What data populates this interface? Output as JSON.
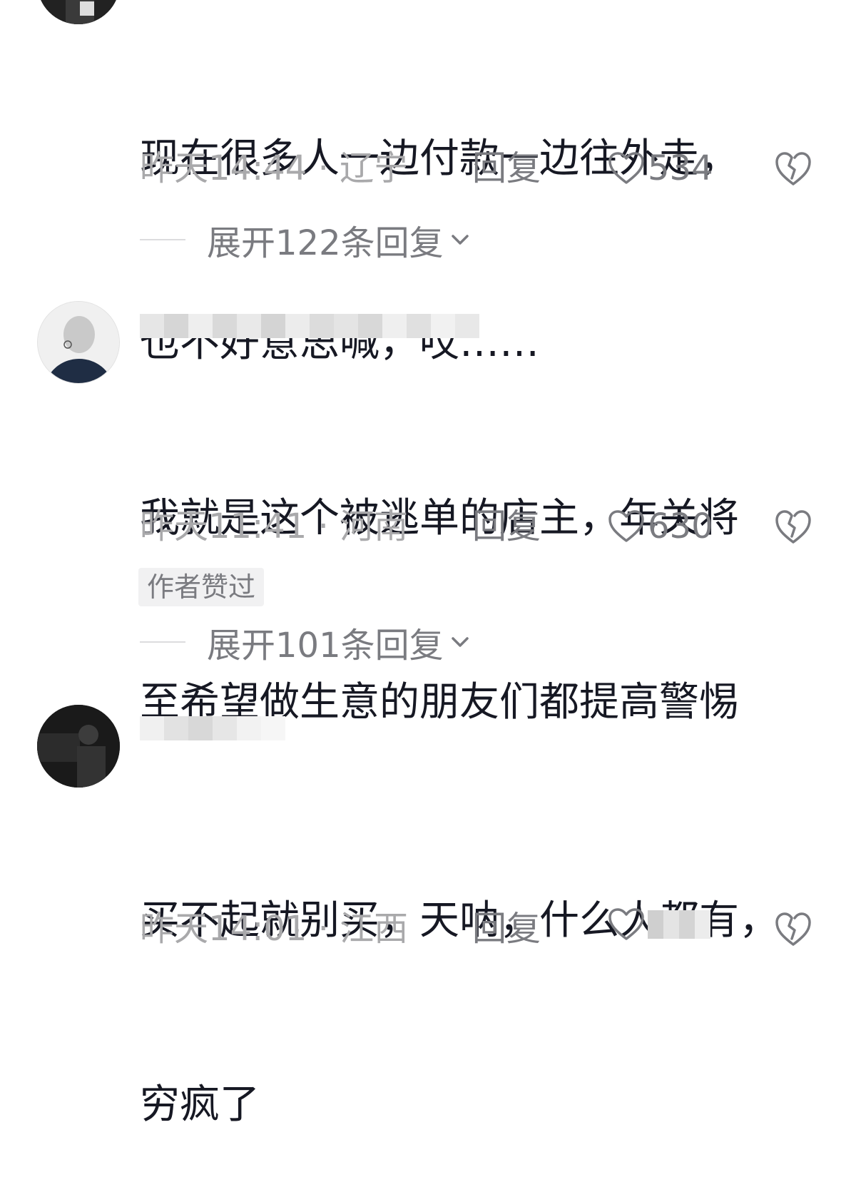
{
  "comments": [
    {
      "text_lines": [
        "现在很多人一边付款一边往外走，",
        "也不好意思喊，哎……"
      ],
      "time_location": "昨天14:44 · 辽宁",
      "reply_label": "回复",
      "likes": "534",
      "expand_label": "展开122条回复"
    },
    {
      "text_lines": [
        "我就是这个被逃单的店主，年关将",
        "至希望做生意的朋友们都提高警惕"
      ],
      "time_location": "昨天11:41 · 河南",
      "reply_label": "回复",
      "likes": "630",
      "badge": "作者赞过",
      "expand_label": "展开101条回复"
    },
    {
      "text_lines": [
        "买不起就别买，天呐，什么人都有，",
        "穷疯了"
      ],
      "time_location": "昨天14:01 · 江西",
      "reply_label": "回复"
    }
  ],
  "icons": {
    "like": "heart-outline-icon",
    "dislike": "broken-heart-icon",
    "expand": "chevron-down-icon"
  },
  "colors": {
    "text": "#161823",
    "meta": "#a9a9ab",
    "action": "#7a7b80",
    "badge_bg": "#f1f1f2"
  }
}
